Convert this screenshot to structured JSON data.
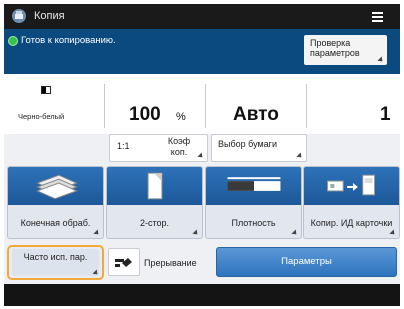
{
  "titlebar": {
    "title": "Копия",
    "icon": "copy-app-icon",
    "menu_icon": "hamburger-menu-icon"
  },
  "status": {
    "text": "Готов к копированию.",
    "icon": "ready-status-icon",
    "check_button": "Проверка параметров"
  },
  "info": {
    "color_mode": "Черно-белый",
    "scale_value": "100",
    "scale_unit": "%",
    "paper": "Авто",
    "copies": "1"
  },
  "ratio": {
    "one_to_one": "1:1",
    "coefficient": "Коэф коп.",
    "paper_select": "Выбор бумаги"
  },
  "tiles": [
    {
      "label": "Конечная обраб.",
      "icon": "finishing-stack-icon"
    },
    {
      "label": "2-стор.",
      "icon": "two-sided-page-icon"
    },
    {
      "label": "Плотность",
      "icon": "density-slider-icon"
    },
    {
      "label": "Копир. ИД карточки",
      "icon": "id-card-copy-icon"
    }
  ],
  "bottom": {
    "frequent": "Часто исп. пар.",
    "interrupt": "Прерывание",
    "interrupt_icon": "interrupt-icon",
    "parameters": "Параметры"
  },
  "colors": {
    "accent_orange": "#f2a83a",
    "status_bar": "#0a4a7e",
    "tile_blue": "#2e72b8",
    "ready_green": "#39c24b"
  }
}
